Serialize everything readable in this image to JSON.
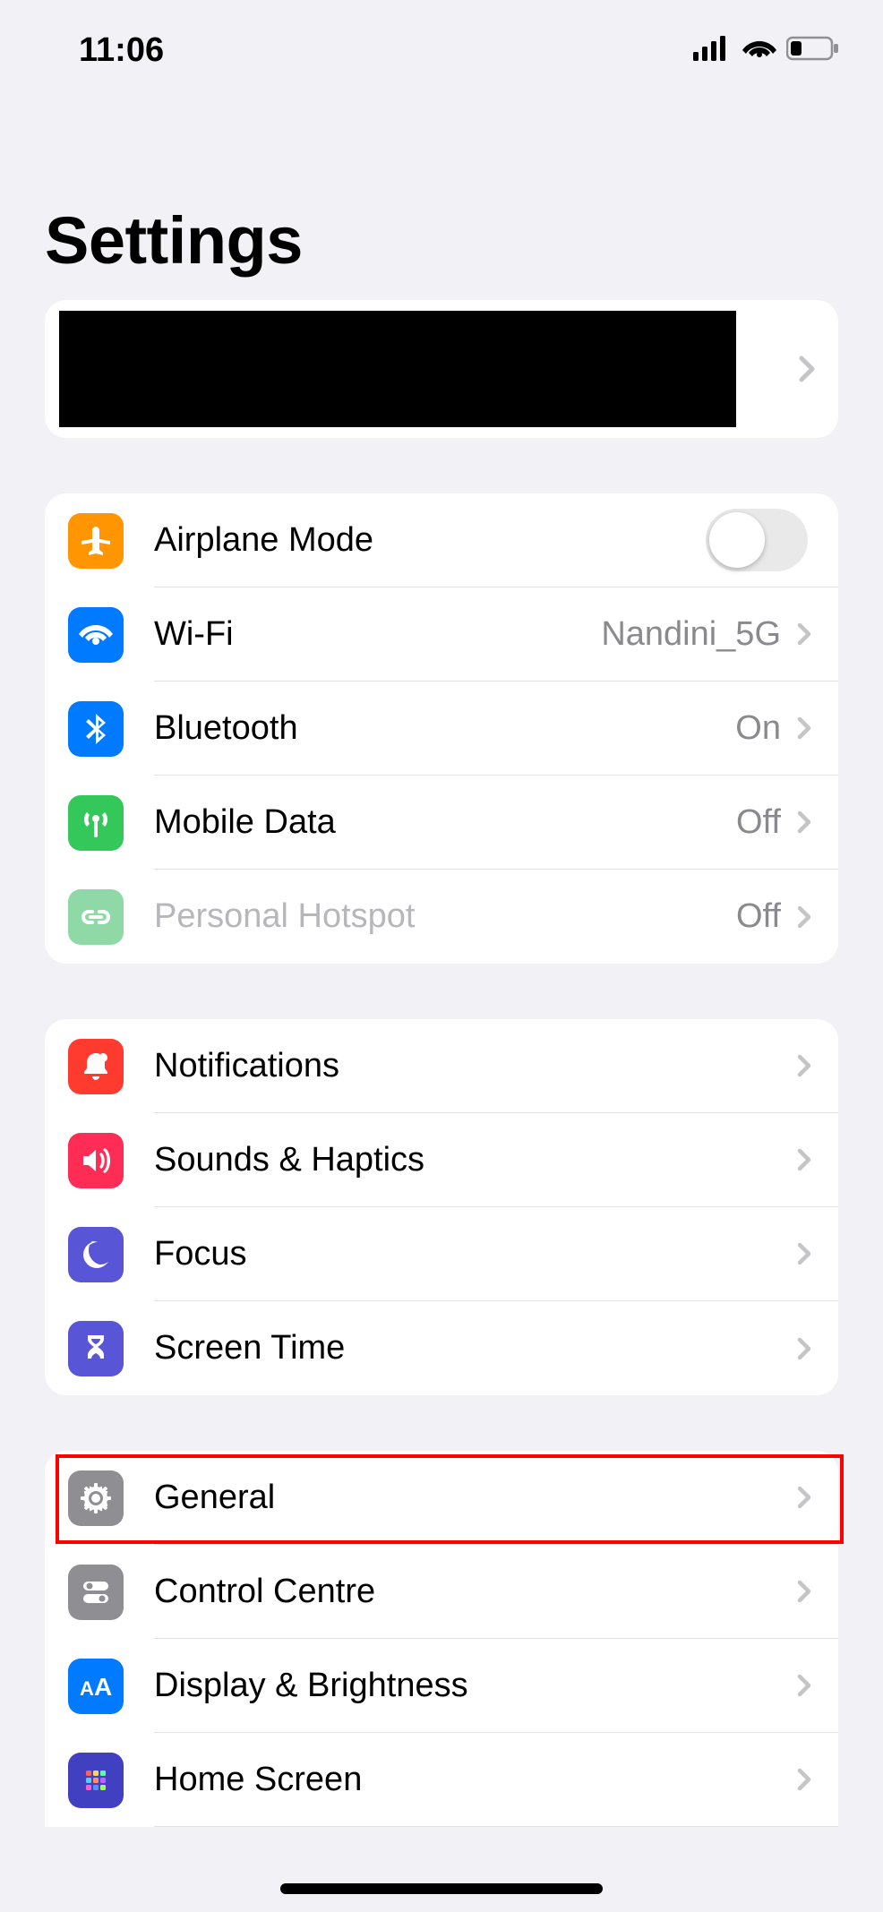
{
  "status": {
    "time": "11:06"
  },
  "header": {
    "title": "Settings"
  },
  "groups": {
    "connectivity": {
      "airplane": "Airplane Mode",
      "wifi": "Wi-Fi",
      "wifi_value": "Nandini_5G",
      "bluetooth": "Bluetooth",
      "bluetooth_value": "On",
      "mobile": "Mobile Data",
      "mobile_value": "Off",
      "hotspot": "Personal Hotspot",
      "hotspot_value": "Off"
    },
    "alerts": {
      "notifications": "Notifications",
      "sounds": "Sounds & Haptics",
      "focus": "Focus",
      "screentime": "Screen Time"
    },
    "system": {
      "general": "General",
      "control": "Control Centre",
      "display": "Display & Brightness",
      "home": "Home Screen"
    }
  }
}
